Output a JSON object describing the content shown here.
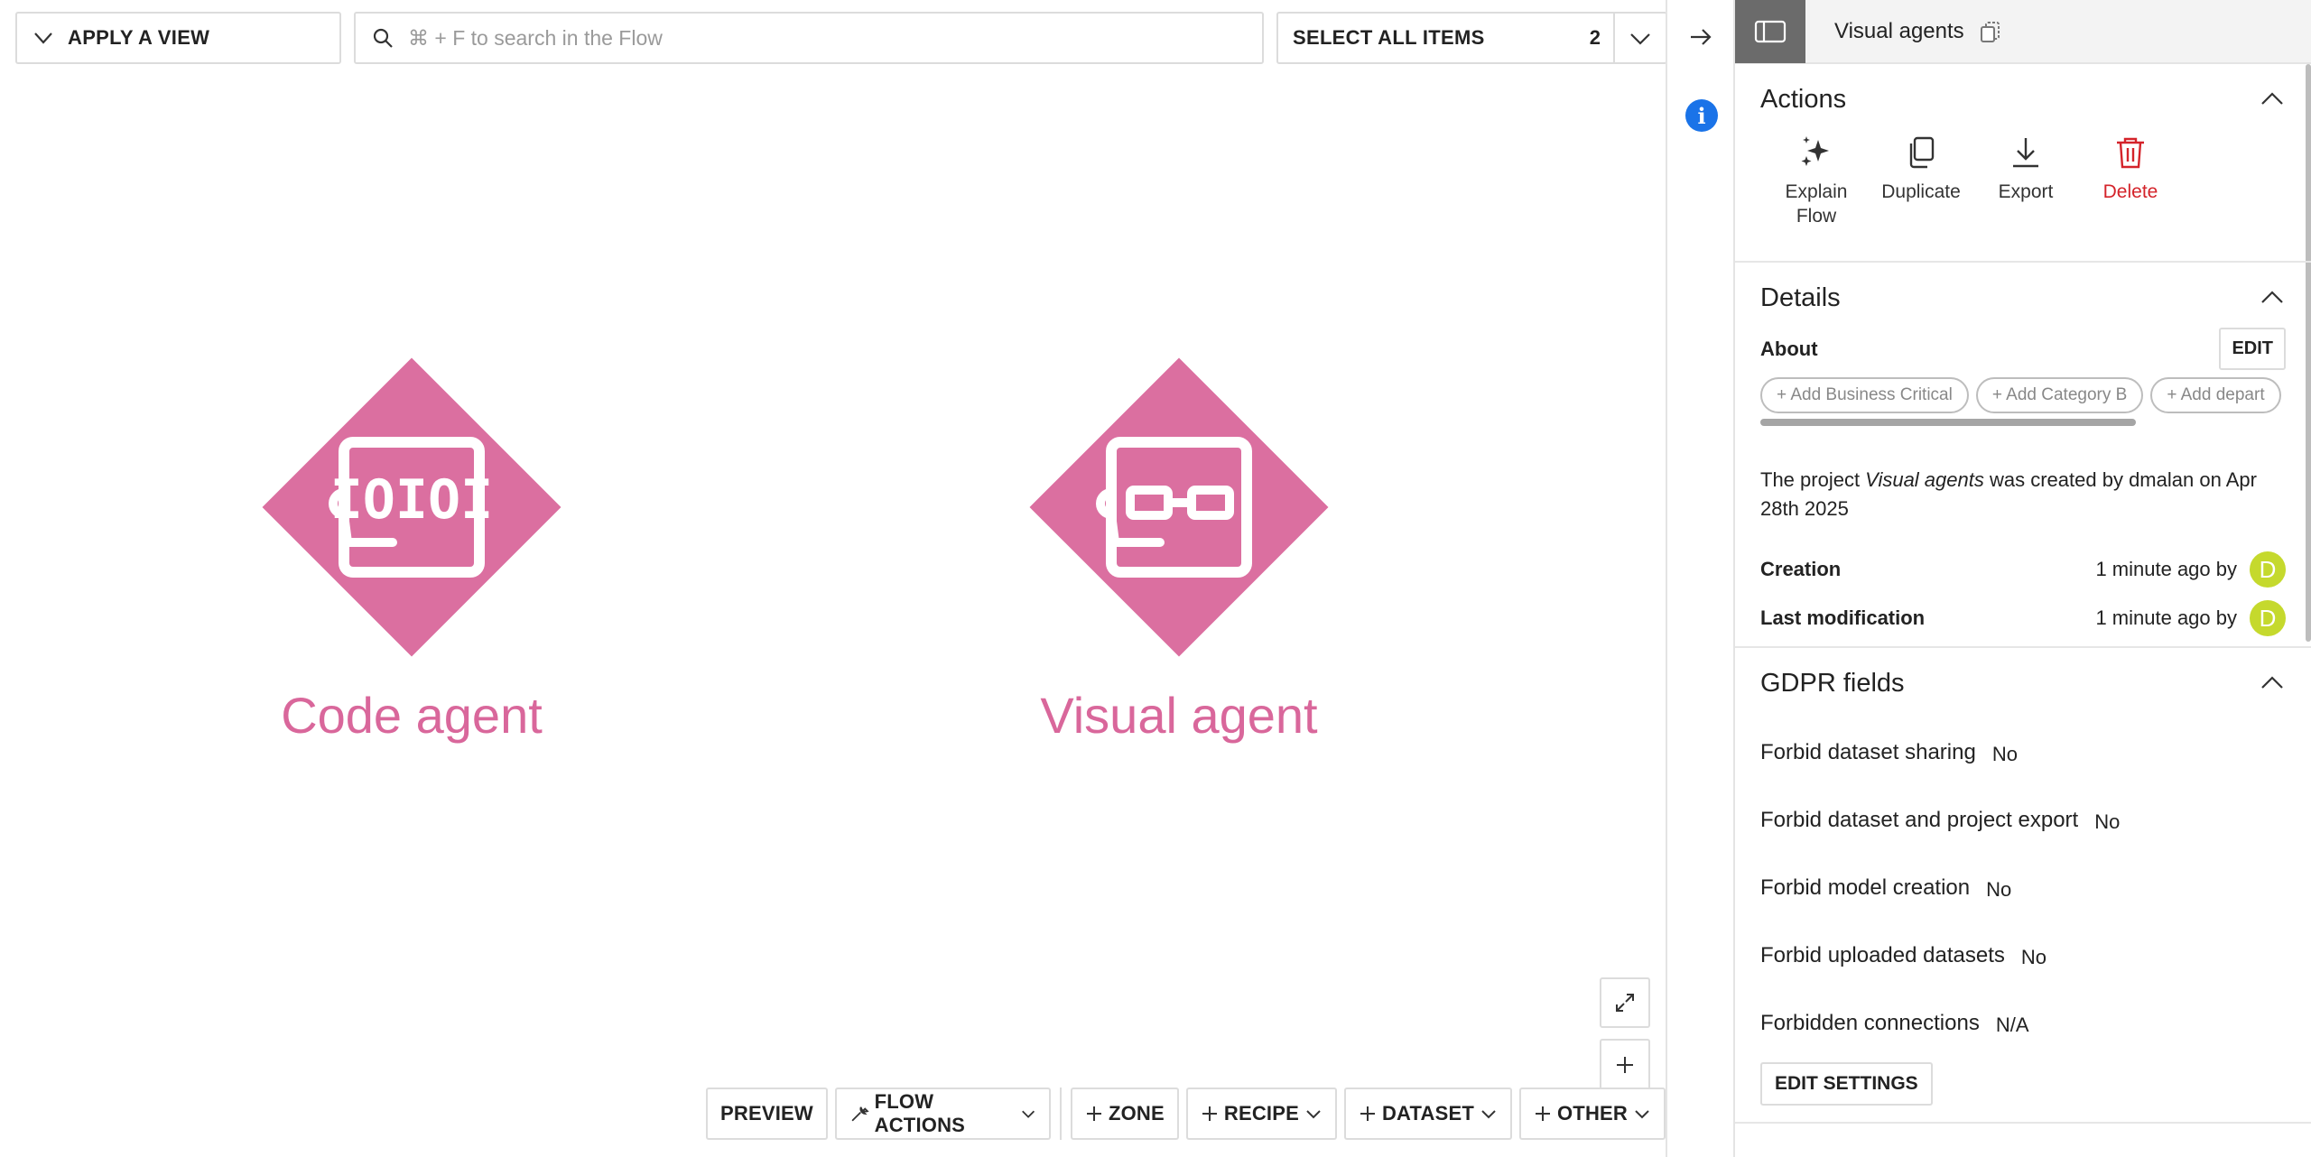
{
  "toolbar": {
    "apply_view_label": "APPLY A VIEW",
    "search_placeholder": "⌘ + F to search in the Flow",
    "select_all_label": "SELECT ALL ITEMS",
    "select_count": "2"
  },
  "flow": {
    "nodes": [
      {
        "label": "Code agent",
        "icon": "code-agent-icon",
        "color": "#db6fa0"
      },
      {
        "label": "Visual agent",
        "icon": "visual-agent-icon",
        "color": "#db6fa0"
      }
    ]
  },
  "bottom_bar": {
    "preview": "PREVIEW",
    "flow_actions": "FLOW ACTIONS",
    "zone": "ZONE",
    "recipe": "RECIPE",
    "dataset": "DATASET",
    "other": "OTHER"
  },
  "panel": {
    "title": "Visual agents",
    "actions": {
      "title": "Actions",
      "items": [
        {
          "label": "Explain Flow",
          "icon": "sparkle-icon"
        },
        {
          "label": "Duplicate",
          "icon": "duplicate-icon"
        },
        {
          "label": "Export",
          "icon": "download-icon"
        },
        {
          "label": "Delete",
          "icon": "trash-icon",
          "color": "#d4232a"
        }
      ]
    },
    "details": {
      "title": "Details",
      "about_label": "About",
      "edit_label": "EDIT",
      "tags": [
        "+ Add Business Critical",
        "+ Add Category B",
        "+ Add depart"
      ],
      "desc_prefix": "The project ",
      "desc_project": "Visual agents",
      "desc_suffix": " was created by dmalan on Apr 28th 2025",
      "creation_label": "Creation",
      "creation_value": "1 minute ago by",
      "modification_label": "Last modification",
      "modification_value": "1 minute ago by",
      "avatar_letter": "D",
      "avatar_color": "#c5d92d"
    },
    "gdpr": {
      "title": "GDPR fields",
      "rows": [
        {
          "label": "Forbid dataset sharing",
          "value": "No"
        },
        {
          "label": "Forbid dataset and project export",
          "value": "No"
        },
        {
          "label": "Forbid model creation",
          "value": "No"
        },
        {
          "label": "Forbid uploaded datasets",
          "value": "No"
        },
        {
          "label": "Forbidden connections",
          "value": "N/A"
        }
      ],
      "edit_settings_label": "EDIT SETTINGS"
    }
  }
}
